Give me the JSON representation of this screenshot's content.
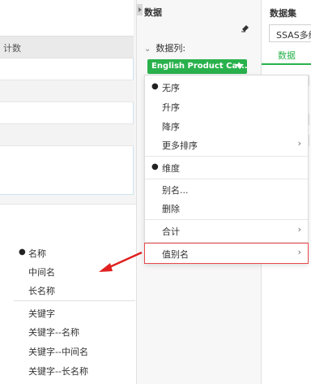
{
  "preview": {
    "column_header": "计数"
  },
  "property_pane": {
    "title": "数据",
    "eraser_icon": "eraser-icon",
    "field_label": "数据列:",
    "field_tag": "English Product Cat..."
  },
  "dataset_pane": {
    "title": "数据集",
    "dataset_value": "SSAS多维",
    "tab_label": "数据"
  },
  "menu": {
    "items": [
      {
        "label": "无序",
        "checked": true,
        "has_submenu": false
      },
      {
        "label": "升序",
        "checked": false,
        "has_submenu": false
      },
      {
        "label": "降序",
        "checked": false,
        "has_submenu": false
      },
      {
        "label": "更多排序",
        "checked": false,
        "has_submenu": true
      },
      {
        "label": "维度",
        "checked": true,
        "has_submenu": false
      },
      {
        "label": "别名...",
        "checked": false,
        "has_submenu": false
      },
      {
        "label": "删除",
        "checked": false,
        "has_submenu": false
      },
      {
        "label": "合计",
        "checked": false,
        "has_submenu": true
      },
      {
        "label": "值别名",
        "checked": false,
        "has_submenu": true,
        "highlighted": true
      }
    ]
  },
  "submenu": {
    "items": [
      {
        "label": "名称",
        "checked": true
      },
      {
        "label": "中间名",
        "checked": false
      },
      {
        "label": "长名称",
        "checked": false
      },
      {
        "label": "关键字",
        "checked": false
      },
      {
        "label": "关键字--名称",
        "checked": false
      },
      {
        "label": "关键字--中间名",
        "checked": false
      },
      {
        "label": "关键字--长名称",
        "checked": false
      }
    ]
  },
  "colors": {
    "accent_green": "#29b14c",
    "highlight_red": "#e8484d",
    "annotation_arrow": "#e02020"
  }
}
